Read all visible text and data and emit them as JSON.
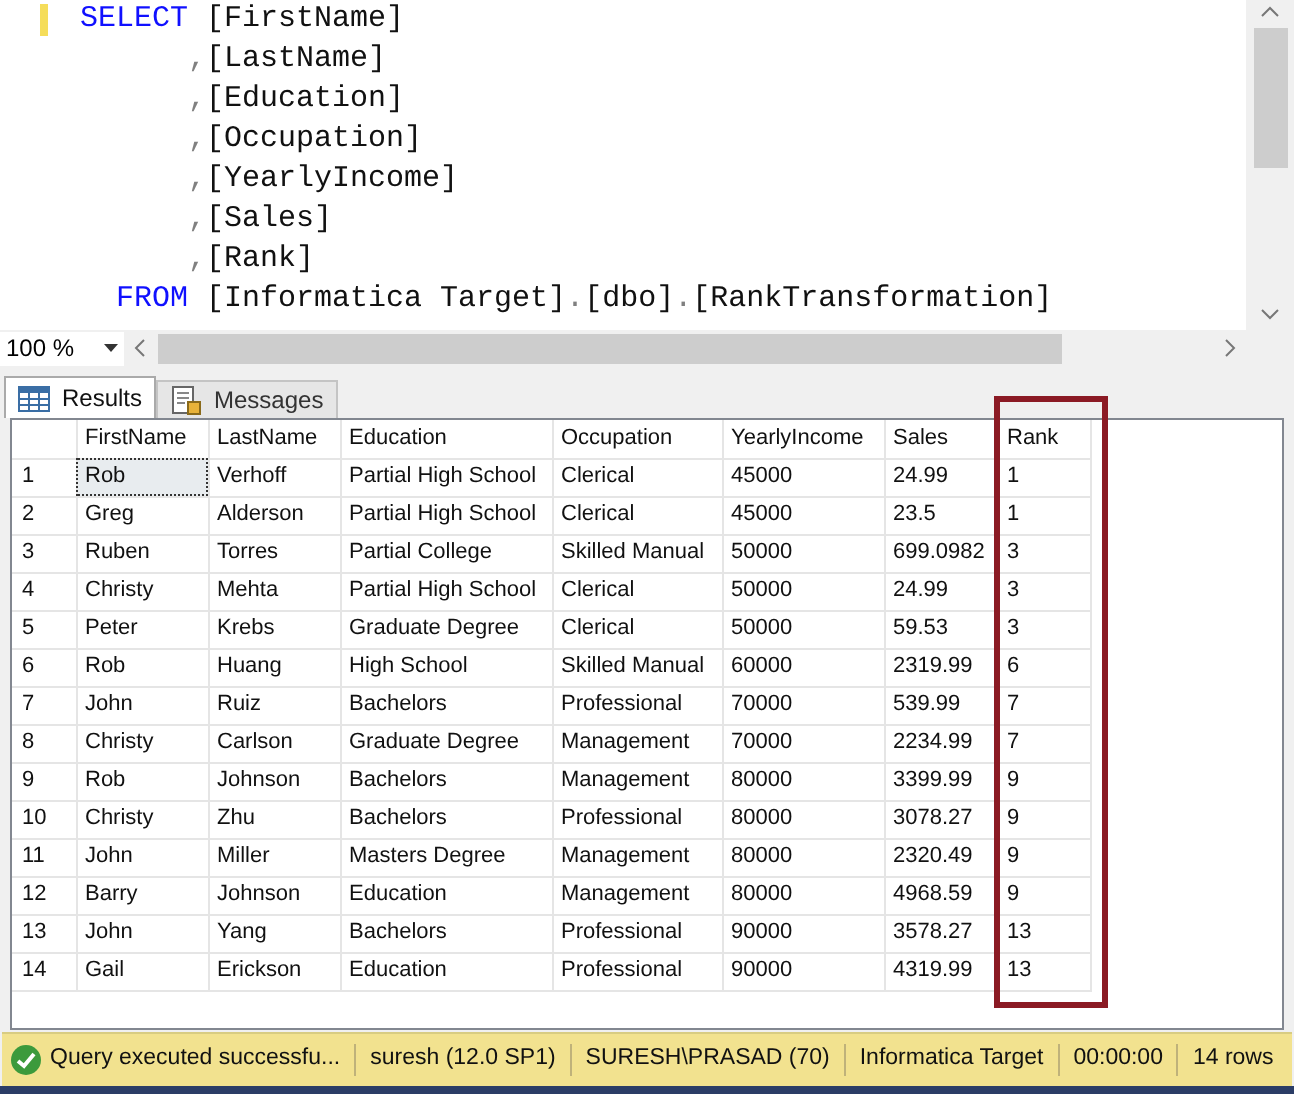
{
  "editor": {
    "lines": [
      {
        "kind": "first",
        "segments": [
          {
            "kind": "keyword",
            "text": "SELECT"
          },
          {
            "kind": "plain",
            "text": " [FirstName]"
          }
        ]
      },
      {
        "kind": "continuation",
        "segments": [
          {
            "kind": "punct",
            "text": ","
          },
          {
            "kind": "plain",
            "text": "[LastName]"
          }
        ]
      },
      {
        "kind": "continuation",
        "segments": [
          {
            "kind": "punct",
            "text": ","
          },
          {
            "kind": "plain",
            "text": "[Education]"
          }
        ]
      },
      {
        "kind": "continuation",
        "segments": [
          {
            "kind": "punct",
            "text": ","
          },
          {
            "kind": "plain",
            "text": "[Occupation]"
          }
        ]
      },
      {
        "kind": "continuation",
        "segments": [
          {
            "kind": "punct",
            "text": ","
          },
          {
            "kind": "plain",
            "text": "[YearlyIncome]"
          }
        ]
      },
      {
        "kind": "continuation",
        "segments": [
          {
            "kind": "punct",
            "text": ","
          },
          {
            "kind": "plain",
            "text": "[Sales]"
          }
        ]
      },
      {
        "kind": "continuation",
        "segments": [
          {
            "kind": "punct",
            "text": ","
          },
          {
            "kind": "plain",
            "text": "[Rank]"
          }
        ]
      },
      {
        "kind": "clause",
        "segments": [
          {
            "kind": "keyword",
            "text": "FROM"
          },
          {
            "kind": "plain",
            "text": " [Informatica Target]"
          },
          {
            "kind": "punct",
            "text": "."
          },
          {
            "kind": "plain",
            "text": "[dbo]"
          },
          {
            "kind": "punct",
            "text": "."
          },
          {
            "kind": "plain",
            "text": "[RankTransformation]"
          }
        ]
      }
    ],
    "zoom": "100 %"
  },
  "tabs": [
    {
      "label": "Results",
      "selected": true
    },
    {
      "label": "Messages",
      "selected": false
    }
  ],
  "table": {
    "columns": [
      "FirstName",
      "LastName",
      "Education",
      "Occupation",
      "YearlyIncome",
      "Sales",
      "Rank"
    ],
    "rows": [
      {
        "number": "1",
        "focused": true,
        "cells": [
          "Rob",
          "Verhoff",
          "Partial High School",
          "Clerical",
          "45000",
          "24.99",
          "1"
        ]
      },
      {
        "number": "2",
        "focused": false,
        "cells": [
          "Greg",
          "Alderson",
          "Partial High School",
          "Clerical",
          "45000",
          "23.5",
          "1"
        ]
      },
      {
        "number": "3",
        "focused": false,
        "cells": [
          "Ruben",
          "Torres",
          "Partial College",
          "Skilled Manual",
          "50000",
          "699.0982",
          "3"
        ]
      },
      {
        "number": "4",
        "focused": false,
        "cells": [
          "Christy",
          "Mehta",
          "Partial High School",
          "Clerical",
          "50000",
          "24.99",
          "3"
        ]
      },
      {
        "number": "5",
        "focused": false,
        "cells": [
          "Peter",
          "Krebs",
          "Graduate Degree",
          "Clerical",
          "50000",
          "59.53",
          "3"
        ]
      },
      {
        "number": "6",
        "focused": false,
        "cells": [
          "Rob",
          "Huang",
          "High School",
          "Skilled Manual",
          "60000",
          "2319.99",
          "6"
        ]
      },
      {
        "number": "7",
        "focused": false,
        "cells": [
          "John",
          "Ruiz",
          "Bachelors",
          "Professional",
          "70000",
          "539.99",
          "7"
        ]
      },
      {
        "number": "8",
        "focused": false,
        "cells": [
          "Christy",
          "Carlson",
          "Graduate Degree",
          "Management",
          "70000",
          "2234.99",
          "7"
        ]
      },
      {
        "number": "9",
        "focused": false,
        "cells": [
          "Rob",
          "Johnson",
          "Bachelors",
          "Management",
          "80000",
          "3399.99",
          "9"
        ]
      },
      {
        "number": "10",
        "focused": false,
        "cells": [
          "Christy",
          "Zhu",
          "Bachelors",
          "Professional",
          "80000",
          "3078.27",
          "9"
        ]
      },
      {
        "number": "11",
        "focused": false,
        "cells": [
          "John",
          "Miller",
          "Masters Degree",
          "Management",
          "80000",
          "2320.49",
          "9"
        ]
      },
      {
        "number": "12",
        "focused": false,
        "cells": [
          "Barry",
          "Johnson",
          "Education",
          "Management",
          "80000",
          "4968.59",
          "9"
        ]
      },
      {
        "number": "13",
        "focused": false,
        "cells": [
          "John",
          "Yang",
          "Bachelors",
          "Professional",
          "90000",
          "3578.27",
          "13"
        ]
      },
      {
        "number": "14",
        "focused": false,
        "cells": [
          "Gail",
          "Erickson",
          "Education",
          "Professional",
          "90000",
          "4319.99",
          "13"
        ]
      }
    ]
  },
  "status_bar": {
    "items": [
      "Query executed successfu...",
      "suresh (12.0 SP1)",
      "SURESH\\PRASAD (70)",
      "Informatica Target",
      "00:00:00",
      "14 rows"
    ]
  }
}
